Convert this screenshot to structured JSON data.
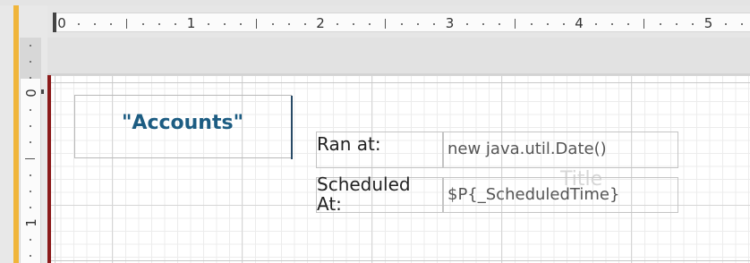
{
  "ruler_horizontal": {
    "labels": [
      "0",
      "1",
      "2",
      "3",
      "4",
      "5"
    ]
  },
  "ruler_vertical": {
    "labels": [
      "0",
      "1"
    ]
  },
  "report": {
    "title_field": "\"Accounts\"",
    "ran_at_label": "Ran at:",
    "ran_at_expression": "new java.util.Date()",
    "scheduled_label_line1": "Scheduled",
    "scheduled_label_line2": "At:",
    "scheduled_expression": "$P{_ScheduledTime}",
    "band_watermark": "Title"
  },
  "colors": {
    "accent": "#f0b53a",
    "title_text": "#1c5c82",
    "margin_line": "#8b1a1a"
  }
}
